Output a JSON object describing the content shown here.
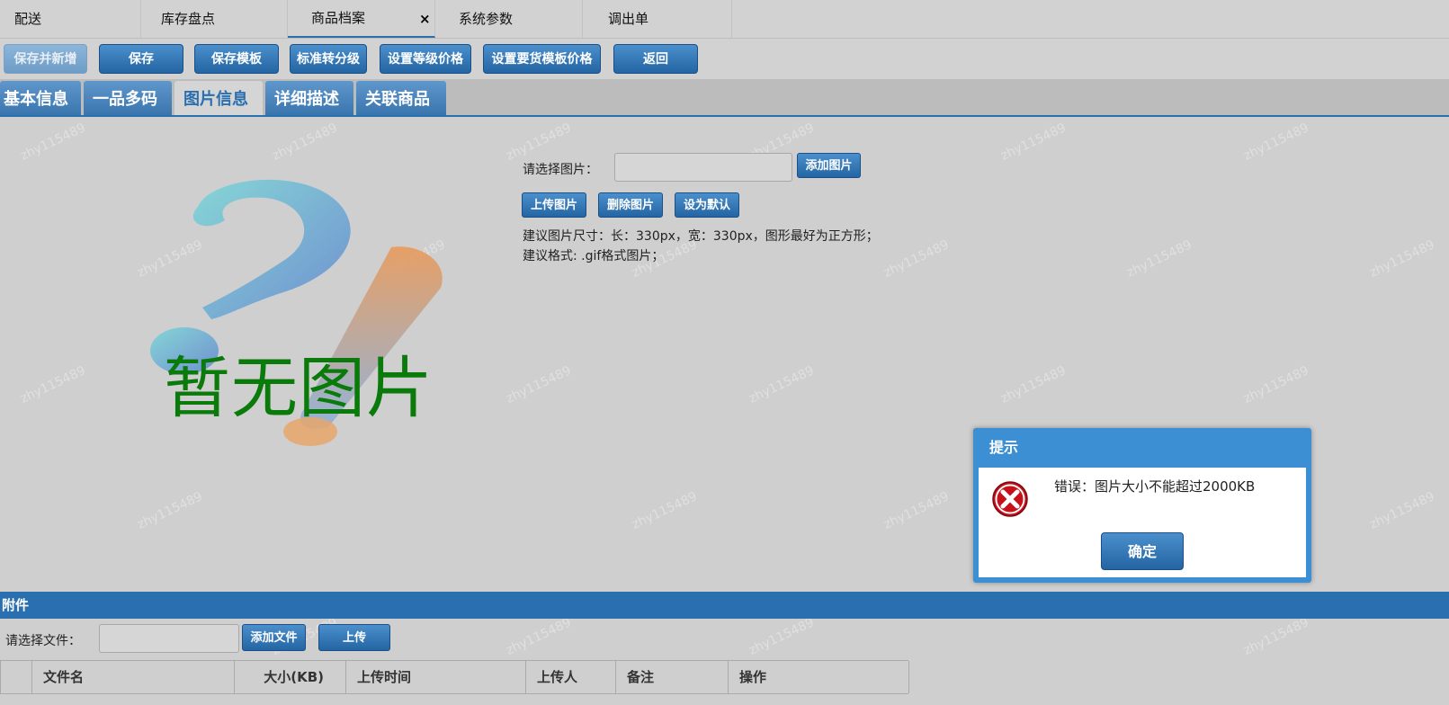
{
  "top_tabs": [
    {
      "label": "配送"
    },
    {
      "label": "库存盘点"
    },
    {
      "label": "商品档案",
      "close": "×"
    },
    {
      "label": "系统参数"
    },
    {
      "label": "调出单"
    }
  ],
  "toolbar": {
    "save_new": "保存并新增",
    "save": "保存",
    "save_template": "保存模板",
    "std_to_grade": "标准转分级",
    "set_grade_price": "设置等级价格",
    "set_order_template_price": "设置要货模板价格",
    "back": "返回"
  },
  "info_tabs": [
    "基本信息",
    "一品多码",
    "图片信息",
    "详细描述",
    "关联商品"
  ],
  "image_section": {
    "placeholder_text": "暂无图片",
    "select_label": "请选择图片：",
    "add_image": "添加图片",
    "upload_image": "上传图片",
    "delete_image": "删除图片",
    "set_default": "设为默认",
    "hint_size": "建议图片尺寸：长：330px，宽：330px，图形最好为正方形；",
    "hint_format": "建议格式: .gif格式图片；"
  },
  "attachments": {
    "header": "附件",
    "select_label": "请选择文件：",
    "add_file": "添加文件",
    "upload": "上传",
    "columns": [
      "文件名",
      "大小(KB)",
      "上传时间",
      "上传人",
      "备注",
      "操作"
    ]
  },
  "watermark": "zhy115489",
  "dialog": {
    "title": "提示",
    "message": "错误：图片大小不能超过2000KB",
    "ok": "确定",
    "icon": "error-icon"
  },
  "colors": {
    "accent": "#2a6fb0",
    "error": "#c8101a",
    "placeholder_text": "#0a7a0a"
  }
}
